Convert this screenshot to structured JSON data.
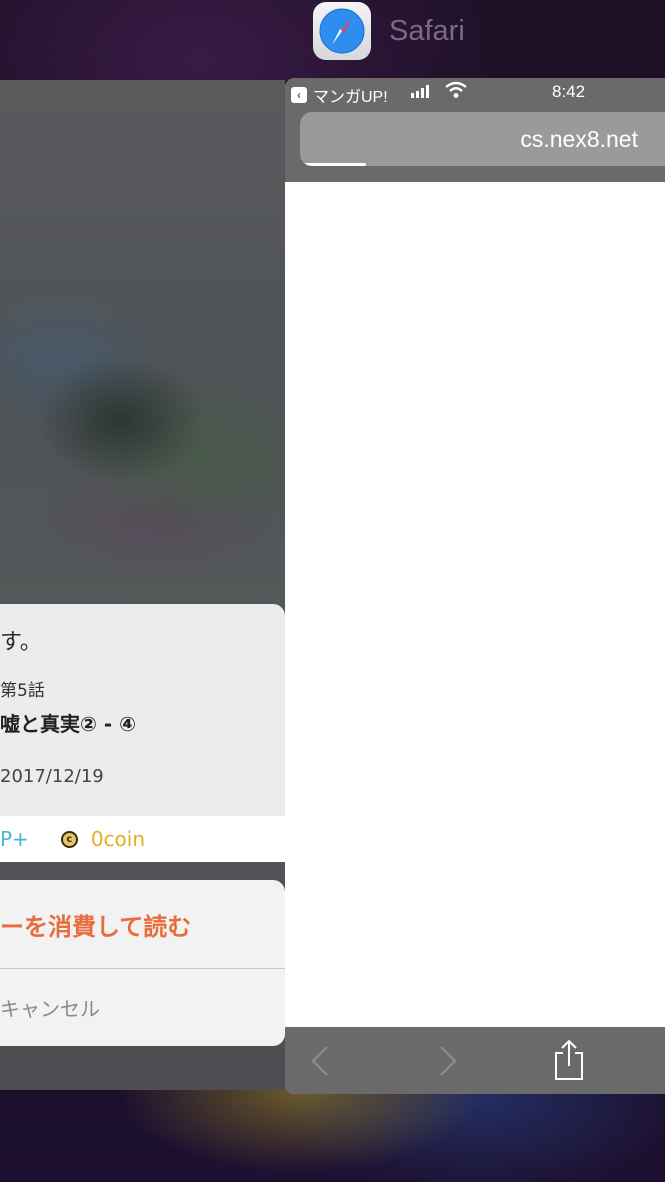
{
  "app_switcher": {
    "app_name": "Safari",
    "app_icon": "safari-compass-icon"
  },
  "left_card": {
    "dialog": {
      "message_tail": "す。",
      "episode": "第5話",
      "subtitle": "嘘と真実② - ④",
      "date": "2017/12/19",
      "points_partial": "P+",
      "coin_icon_letter": "c",
      "coin_label": "0coin"
    },
    "action_sheet": {
      "consume_label": "ーを消費して読む",
      "cancel_label": "キャンセル"
    }
  },
  "safari_card": {
    "status_bar": {
      "back_app_label": "マンガUP!",
      "time": "8:42"
    },
    "address_bar": {
      "url": "cs.nex8.net",
      "load_progress_percent": 17
    },
    "toolbar": {
      "back_icon": "chevron-left-icon",
      "forward_icon": "chevron-right-icon",
      "share_icon": "share-icon"
    }
  },
  "colors": {
    "points": "#46b7d8",
    "coin": "#e0b020",
    "consume_action": "#e86d3c",
    "safari_chrome": "#6a6a6a"
  }
}
